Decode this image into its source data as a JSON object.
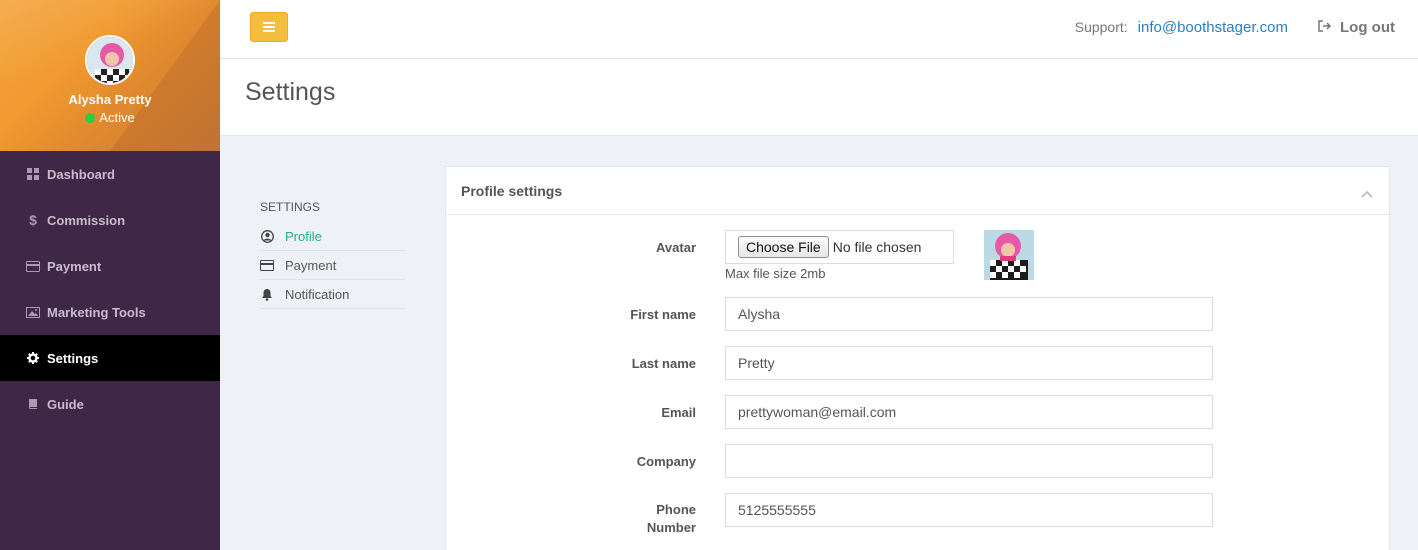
{
  "user": {
    "name": "Alysha Pretty",
    "status": "Active"
  },
  "sidebar": {
    "items": [
      {
        "label": "Dashboard",
        "icon": "dashboard-icon"
      },
      {
        "label": "Commission",
        "icon": "dollar-icon"
      },
      {
        "label": "Payment",
        "icon": "credit-card-icon"
      },
      {
        "label": "Marketing Tools",
        "icon": "image-icon"
      },
      {
        "label": "Settings",
        "icon": "gear-icon",
        "active": true
      },
      {
        "label": "Guide",
        "icon": "book-icon"
      }
    ]
  },
  "topbar": {
    "support_label": "Support:",
    "support_email": "info@boothstager.com",
    "logout_label": "Log out"
  },
  "page": {
    "title": "Settings"
  },
  "subnav": {
    "title": "SETTINGS",
    "items": [
      {
        "label": "Profile",
        "icon": "user-circle-icon",
        "active": true
      },
      {
        "label": "Payment",
        "icon": "credit-card-icon"
      },
      {
        "label": "Notification",
        "icon": "bell-icon"
      }
    ]
  },
  "panel": {
    "title": "Profile settings",
    "avatar": {
      "label": "Avatar",
      "button_label": "Choose File",
      "file_status": "No file chosen",
      "hint": "Max file size 2mb"
    },
    "fields": {
      "first_name": {
        "label": "First name",
        "value": "Alysha"
      },
      "last_name": {
        "label": "Last name",
        "value": "Pretty"
      },
      "email": {
        "label": "Email",
        "value": "prettywoman@email.com"
      },
      "company": {
        "label": "Company",
        "value": ""
      },
      "phone_line1": "Phone",
      "phone_line2": "Number",
      "phone_value": "5125555555"
    }
  },
  "colors": {
    "sidebar_bg": "#3f2748",
    "accent_green": "#1fb38b",
    "menu_button": "#f3be3c",
    "link_blue": "#2a7fc0"
  }
}
